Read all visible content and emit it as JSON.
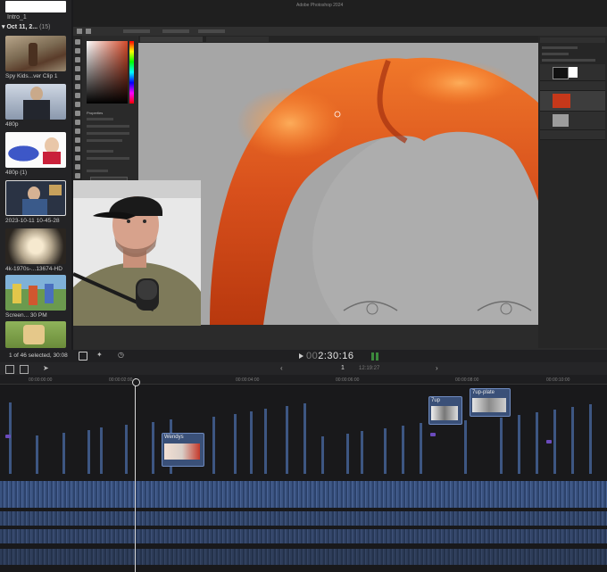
{
  "browser": {
    "event_name": "Intro_1",
    "date_group": "Oct 11, 2...",
    "date_count": "(15)",
    "clips": [
      {
        "label": "Spy Kids...ver Clip 1"
      },
      {
        "label": "480p"
      },
      {
        "label": "480p (1)"
      },
      {
        "label": "2023-10-11 10-45-28"
      },
      {
        "label": "4k-1970s-...13674-HD"
      },
      {
        "label": "Screen... 30 PM"
      },
      {
        "label": ""
      }
    ]
  },
  "viewer": {
    "selection_info": "1 of 46 selected, 30:08",
    "timecode_dim": "00",
    "timecode": "2:30:16"
  },
  "timeline": {
    "page": "1",
    "duration": "12:19:27",
    "ruler_labels": [
      "00:00:00:00",
      "00:00:02:00",
      "00:00:04:00",
      "00:00:06:00",
      "00:00:08:00",
      "00:00:10:00"
    ],
    "clip_names": [
      "Wendys",
      "7up",
      "7up-plate"
    ]
  },
  "photoshop": {
    "window_title": "Adobe Photoshop 2024",
    "properties_title": "Properties"
  },
  "colors": {
    "hair": "#d8501c",
    "timeline_clip": "#3d5682",
    "accent": "#2d6be0"
  }
}
